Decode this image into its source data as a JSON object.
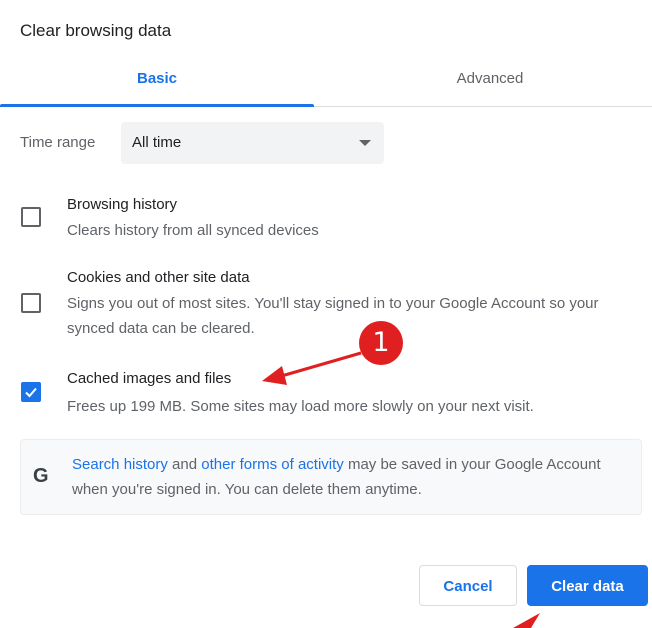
{
  "dialog": {
    "title": "Clear browsing data"
  },
  "tabs": [
    {
      "label": "Basic",
      "active": true
    },
    {
      "label": "Advanced",
      "active": false
    }
  ],
  "time_range": {
    "label": "Time range",
    "value": "All time"
  },
  "options": [
    {
      "title": "Browsing history",
      "description": "Clears history from all synced devices",
      "checked": false
    },
    {
      "title": "Cookies and other site data",
      "description": "Signs you out of most sites. You'll stay signed in to your Google Account so your synced data can be cleared.",
      "checked": false
    },
    {
      "title": "Cached images and files",
      "description": "Frees up 199 MB. Some sites may load more slowly on your next visit.",
      "checked": true
    }
  ],
  "info": {
    "icon_letter": "G",
    "link1": "Search history",
    "text1": " and ",
    "link2": "other forms of activity",
    "text2": " may be saved in your Google Account when you're signed in. You can delete them anytime."
  },
  "buttons": {
    "cancel": "Cancel",
    "clear": "Clear data"
  },
  "annotation": {
    "number": "1",
    "color": "#e02020"
  },
  "colors": {
    "accent": "#1a73e8",
    "annotation": "#e02020"
  }
}
